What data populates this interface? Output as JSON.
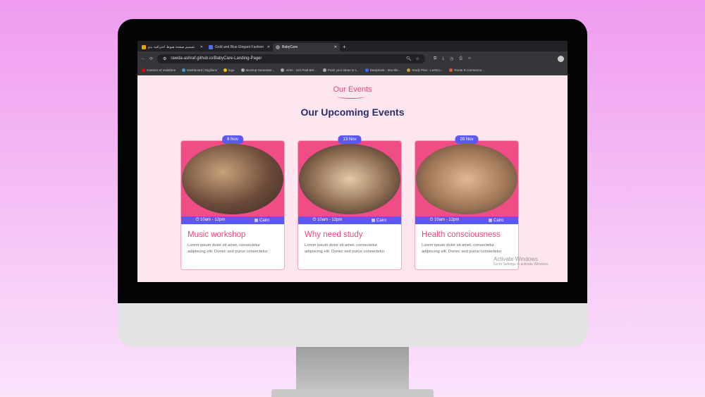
{
  "browser": {
    "tabs": [
      {
        "label": "تصميم صفحة هبوط احترافية بدو",
        "active": false
      },
      {
        "label": "Gold and Blue Elegant Fashion",
        "active": false
      },
      {
        "label": "BabyCare",
        "active": true
      }
    ],
    "url": "rawda-ashraf.github.io/BabyCare-Landing-Page/",
    "bookmarks": [
      "Careers at Vodafone",
      "Dashboard | Digilians",
      "logo",
      "Mockup Generator...",
      "Airtm - Get Paid Bet...",
      "Push your ideas to t...",
      "DeepSeek - Into the...",
      "Study Plan - LeetCo...",
      "Route E-commerce..."
    ]
  },
  "page": {
    "kicker": "Our Events",
    "heading": "Our Upcoming Events",
    "events": [
      {
        "date": "8 Nov",
        "time": "10am - 12pm",
        "location": "Cairo",
        "title": "Music workshop",
        "desc": "Lorem ipsum dolor sit amet, consectetur adipiscing elit. Donec sed purus consectetur."
      },
      {
        "date": "13 Nov",
        "time": "10am - 12pm",
        "location": "Cairo",
        "title": "Why need study",
        "desc": "Lorem ipsum dolor sit amet, consectetur adipiscing elit. Donec sed purus consectetur."
      },
      {
        "date": "28 Nov",
        "time": "10am - 12pm",
        "location": "Cairo",
        "title": "Health consciousness",
        "desc": "Lorem ipsum dolor sit amet, consectetur adipiscing elit. Donec sed purus consectetur."
      }
    ]
  },
  "watermark": {
    "title": "Activate Windows",
    "sub": "Go to Settings to activate Windows."
  }
}
